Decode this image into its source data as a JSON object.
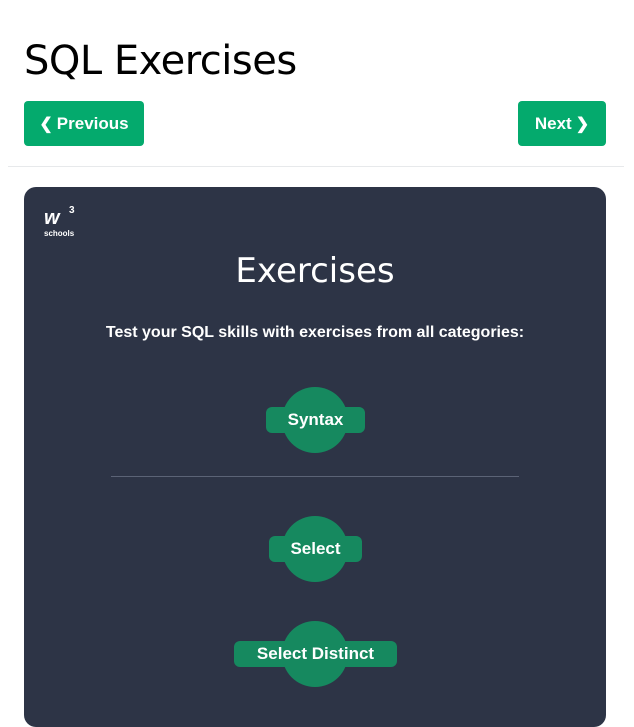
{
  "header": {
    "title": "SQL Exercises",
    "previous_label": "Previous",
    "next_label": "Next"
  },
  "panel": {
    "logo_text": "w",
    "logo_superscript": "3",
    "logo_subtext": "schools",
    "title": "Exercises",
    "subtitle": "Test your SQL skills with exercises from all categories:",
    "categories": [
      {
        "label": "Syntax"
      },
      {
        "label": "Select"
      },
      {
        "label": "Select Distinct"
      }
    ]
  },
  "colors": {
    "accent": "#04aa6d",
    "panel_bg": "#2d3446",
    "category_bg": "#16895f"
  },
  "icons": {
    "previous": "chevron-left-icon",
    "next": "chevron-right-icon"
  }
}
